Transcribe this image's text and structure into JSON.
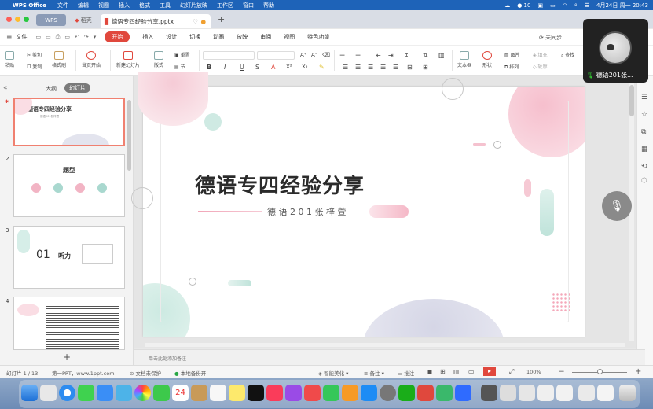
{
  "menubar": {
    "app_name": "WPS Office",
    "items": [
      "文件",
      "编辑",
      "视图",
      "插入",
      "格式",
      "工具",
      "幻灯片放映",
      "工作区",
      "窗口",
      "帮助"
    ],
    "battery": "10",
    "date_time": "4月24日 周一  20:43"
  },
  "tabs": {
    "wps_tab": "WPS",
    "docer_tab": "稻壳",
    "document_tab": "德语专四经验分享.pptx"
  },
  "ribbon": {
    "file_label": "文件",
    "tabs": [
      "开始",
      "插入",
      "设计",
      "切换",
      "动画",
      "放映",
      "审阅",
      "视图",
      "特色功能"
    ],
    "active_index": 0,
    "sync_label": "未同步"
  },
  "toolbar": {
    "paste": "粘贴",
    "cut": "剪切",
    "copy": "复制",
    "format_painter": "格式刷",
    "play_from_current": "当页开始",
    "new_slide": "新建幻灯片",
    "layout": "版式",
    "reset": "重置",
    "section": "节",
    "textbox": "文本框",
    "shape": "形状",
    "picture": "图片",
    "arrange": "排列",
    "fill": "填充",
    "outline": "轮廓",
    "find": "查找"
  },
  "left_panel": {
    "outline_tab": "大纲",
    "slides_tab": "幻灯片",
    "thumbs": [
      {
        "num": "1",
        "title": "德语专四经验分享",
        "subtitle": "德语201张梓萱"
      },
      {
        "num": "2",
        "title": "题型"
      },
      {
        "num": "3",
        "title": "听力",
        "number": "01"
      },
      {
        "num": "4"
      }
    ]
  },
  "slide": {
    "title": "德语专四经验分享",
    "subtitle": "德 语 2 0 1 张 梓 萱"
  },
  "notes_placeholder": "单击此处添加备注",
  "video": {
    "participant_name": "德语201张..."
  },
  "status": {
    "slide_count": "幻灯片 1 / 13",
    "template": "第一PPT，www.1ppt.com",
    "protect": "文档未保护",
    "backup": "本地备份开",
    "beautify": "智能美化",
    "notes_btn": "备注",
    "comments_btn": "批注",
    "zoom": "100%"
  },
  "colors": {
    "menubar": "#1e63b8",
    "accent_red": "#e0483d",
    "pink": "#f3b8c8",
    "teal": "#a9d8cf"
  }
}
